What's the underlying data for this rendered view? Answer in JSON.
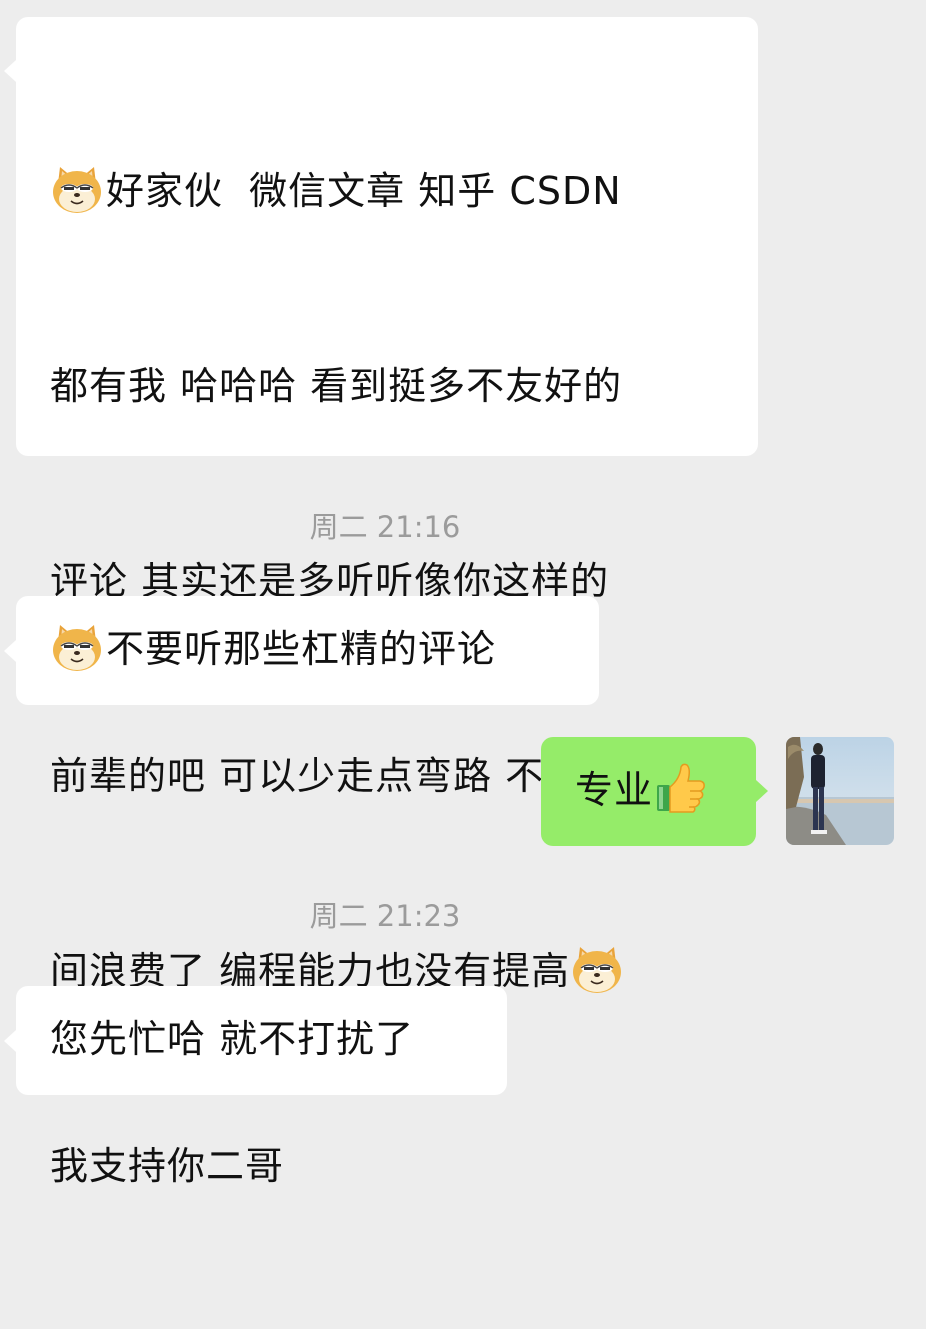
{
  "messages": [
    {
      "side": "left",
      "text_lines": [
        "好家伙  微信文章 知乎 CSDN",
        "都有我 哈哈哈 看到挺多不友好的",
        "评论 其实还是多听听像你这样的",
        "前辈的吧 可以少走点弯路 不然时",
        "间浪费了 编程能力也没有提高",
        "我支持你二哥"
      ],
      "emoji_first": "doge-emoji",
      "emoji_line5": "doge-emoji"
    },
    {
      "timestamp": "周二 21:16"
    },
    {
      "side": "left",
      "text": "不要听那些杠精的评论",
      "emoji": "doge-emoji"
    },
    {
      "side": "right",
      "text": "专业",
      "emoji": "thumbs-up-emoji"
    },
    {
      "timestamp": "周二 21:23"
    },
    {
      "side": "left",
      "text": "您先忙哈 就不打扰了"
    }
  ],
  "colors": {
    "background": "#ededed",
    "incoming_bubble": "#ffffff",
    "outgoing_bubble": "#95ec69",
    "timestamp": "#9b9b9b",
    "text": "#111111"
  },
  "icons": [
    "doge-emoji",
    "thumbs-up-emoji",
    "user-avatar"
  ]
}
